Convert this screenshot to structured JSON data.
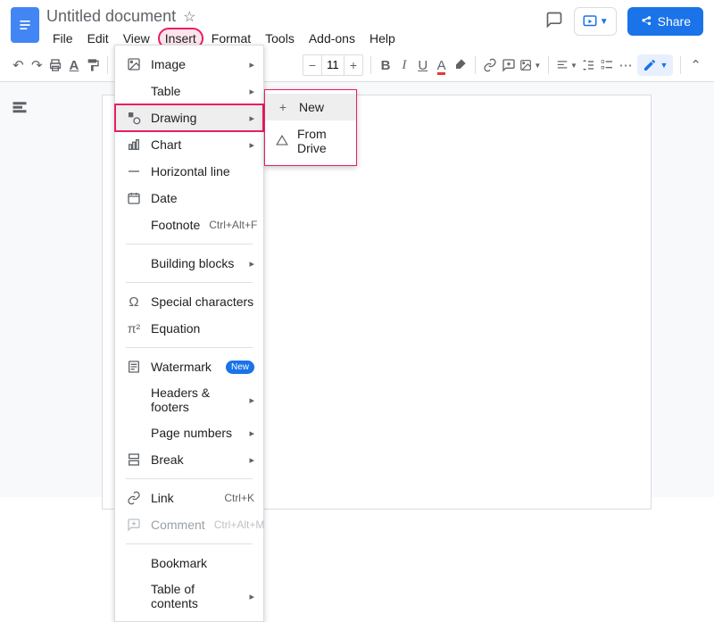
{
  "header": {
    "title": "Untitled document",
    "share": "Share"
  },
  "menubar": [
    "File",
    "Edit",
    "View",
    "Insert",
    "Format",
    "Tools",
    "Add-ons",
    "Help"
  ],
  "toolbar": {
    "font_size": "11"
  },
  "insert_menu": {
    "image": "Image",
    "table": "Table",
    "drawing": "Drawing",
    "chart": "Chart",
    "hrule": "Horizontal line",
    "date": "Date",
    "footnote": "Footnote",
    "footnote_sc": "Ctrl+Alt+F",
    "building_blocks": "Building blocks",
    "special_chars": "Special characters",
    "equation": "Equation",
    "watermark": "Watermark",
    "new_badge": "New",
    "headers_footers": "Headers & footers",
    "page_numbers": "Page numbers",
    "break": "Break",
    "link": "Link",
    "link_sc": "Ctrl+K",
    "comment": "Comment",
    "comment_sc": "Ctrl+Alt+M",
    "bookmark": "Bookmark",
    "toc": "Table of contents"
  },
  "drawing_submenu": {
    "new": "New",
    "from_drive": "From Drive"
  }
}
